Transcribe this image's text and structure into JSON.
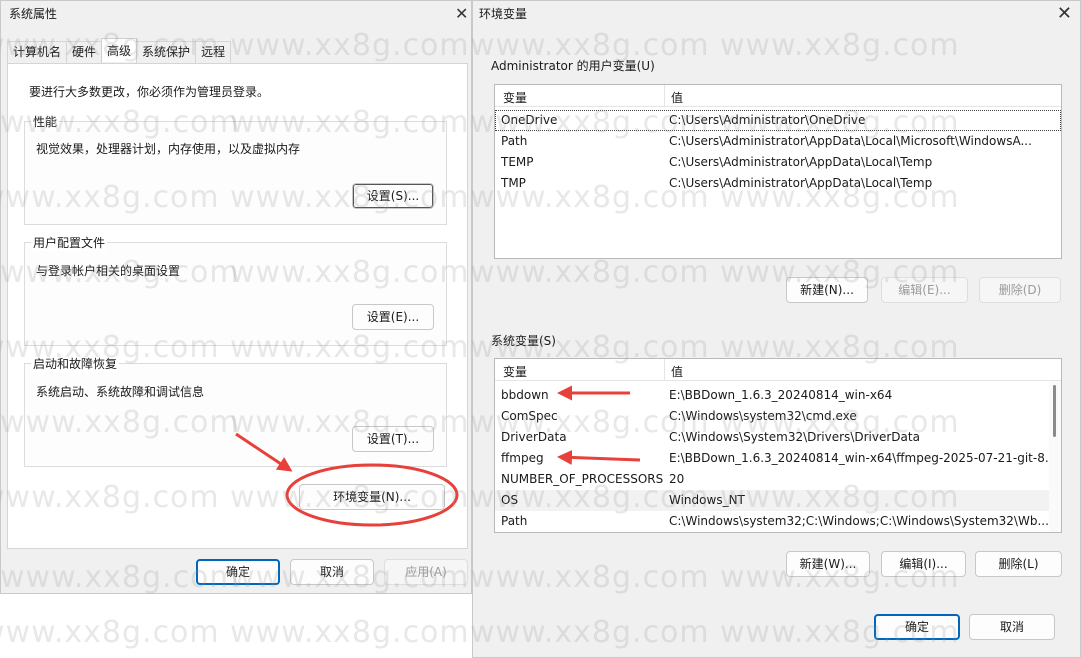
{
  "sysprops": {
    "title": "系统属性",
    "tabs": [
      "计算机名",
      "硬件",
      "高级",
      "系统保护",
      "远程"
    ],
    "admin_note": "要进行大多数更改，你必须作为管理员登录。",
    "perf": {
      "title": "性能",
      "desc": "视觉效果，处理器计划，内存使用，以及虚拟内存",
      "btn": "设置(S)..."
    },
    "profile": {
      "title": "用户配置文件",
      "desc": "与登录帐户相关的桌面设置",
      "btn": "设置(E)..."
    },
    "startup": {
      "title": "启动和故障恢复",
      "desc": "系统启动、系统故障和调试信息",
      "btn": "设置(T)..."
    },
    "env_btn": "环境变量(N)...",
    "ok": "确定",
    "cancel": "取消",
    "apply": "应用(A)"
  },
  "env": {
    "title": "环境变量",
    "user_label": "Administrator 的用户变量(U)",
    "sys_label": "系统变量(S)",
    "col_var": "变量",
    "col_val": "值",
    "user_vars": [
      {
        "name": "OneDrive",
        "value": "C:\\Users\\Administrator\\OneDrive"
      },
      {
        "name": "Path",
        "value": "C:\\Users\\Administrator\\AppData\\Local\\Microsoft\\WindowsA..."
      },
      {
        "name": "TEMP",
        "value": "C:\\Users\\Administrator\\AppData\\Local\\Temp"
      },
      {
        "name": "TMP",
        "value": "C:\\Users\\Administrator\\AppData\\Local\\Temp"
      }
    ],
    "sys_vars": [
      {
        "name": "bbdown",
        "value": "E:\\BBDown_1.6.3_20240814_win-x64"
      },
      {
        "name": "ComSpec",
        "value": "C:\\Windows\\system32\\cmd.exe"
      },
      {
        "name": "DriverData",
        "value": "C:\\Windows\\System32\\Drivers\\DriverData"
      },
      {
        "name": "ffmpeg",
        "value": "E:\\BBDown_1.6.3_20240814_win-x64\\ffmpeg-2025-07-21-git-8..."
      },
      {
        "name": "NUMBER_OF_PROCESSORS",
        "value": "20"
      },
      {
        "name": "OS",
        "value": "Windows_NT"
      },
      {
        "name": "Path",
        "value": "C:\\Windows\\system32;C:\\Windows;C:\\Windows\\System32\\Wb..."
      }
    ],
    "user_btns": {
      "new": "新建(N)...",
      "edit": "编辑(E)...",
      "delete": "删除(D)"
    },
    "sys_btns": {
      "new": "新建(W)...",
      "edit": "编辑(I)...",
      "delete": "删除(L)"
    },
    "ok": "确定",
    "cancel": "取消"
  },
  "watermark": "www.xx8g.com",
  "colors": {
    "accent": "#0067c0",
    "annotation": "#e8403a"
  },
  "icons": {
    "close": "close-icon"
  }
}
